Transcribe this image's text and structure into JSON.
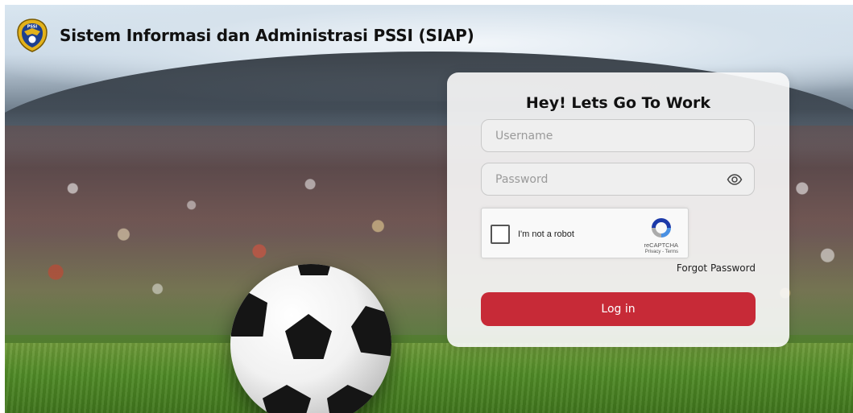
{
  "header": {
    "title": "Sistem Informasi dan Administrasi PSSI (SIAP)",
    "logo_icon": "pssi-garuda-emblem",
    "logo_text": "PSSI"
  },
  "login": {
    "heading": "Hey! Lets Go To Work",
    "username_placeholder": "Username",
    "username_value": "",
    "password_placeholder": "Password",
    "password_value": "",
    "password_toggle_icon": "eye-icon",
    "forgot_label": "Forgot Password",
    "submit_label": "Log in"
  },
  "captcha": {
    "checkbox_label": "I'm not a robot",
    "brand": "reCAPTCHA",
    "links": "Privacy - Terms",
    "checked": false
  },
  "colors": {
    "primary_button": "#c72a37",
    "card_background": "#fafafa",
    "title_text": "#111111"
  }
}
